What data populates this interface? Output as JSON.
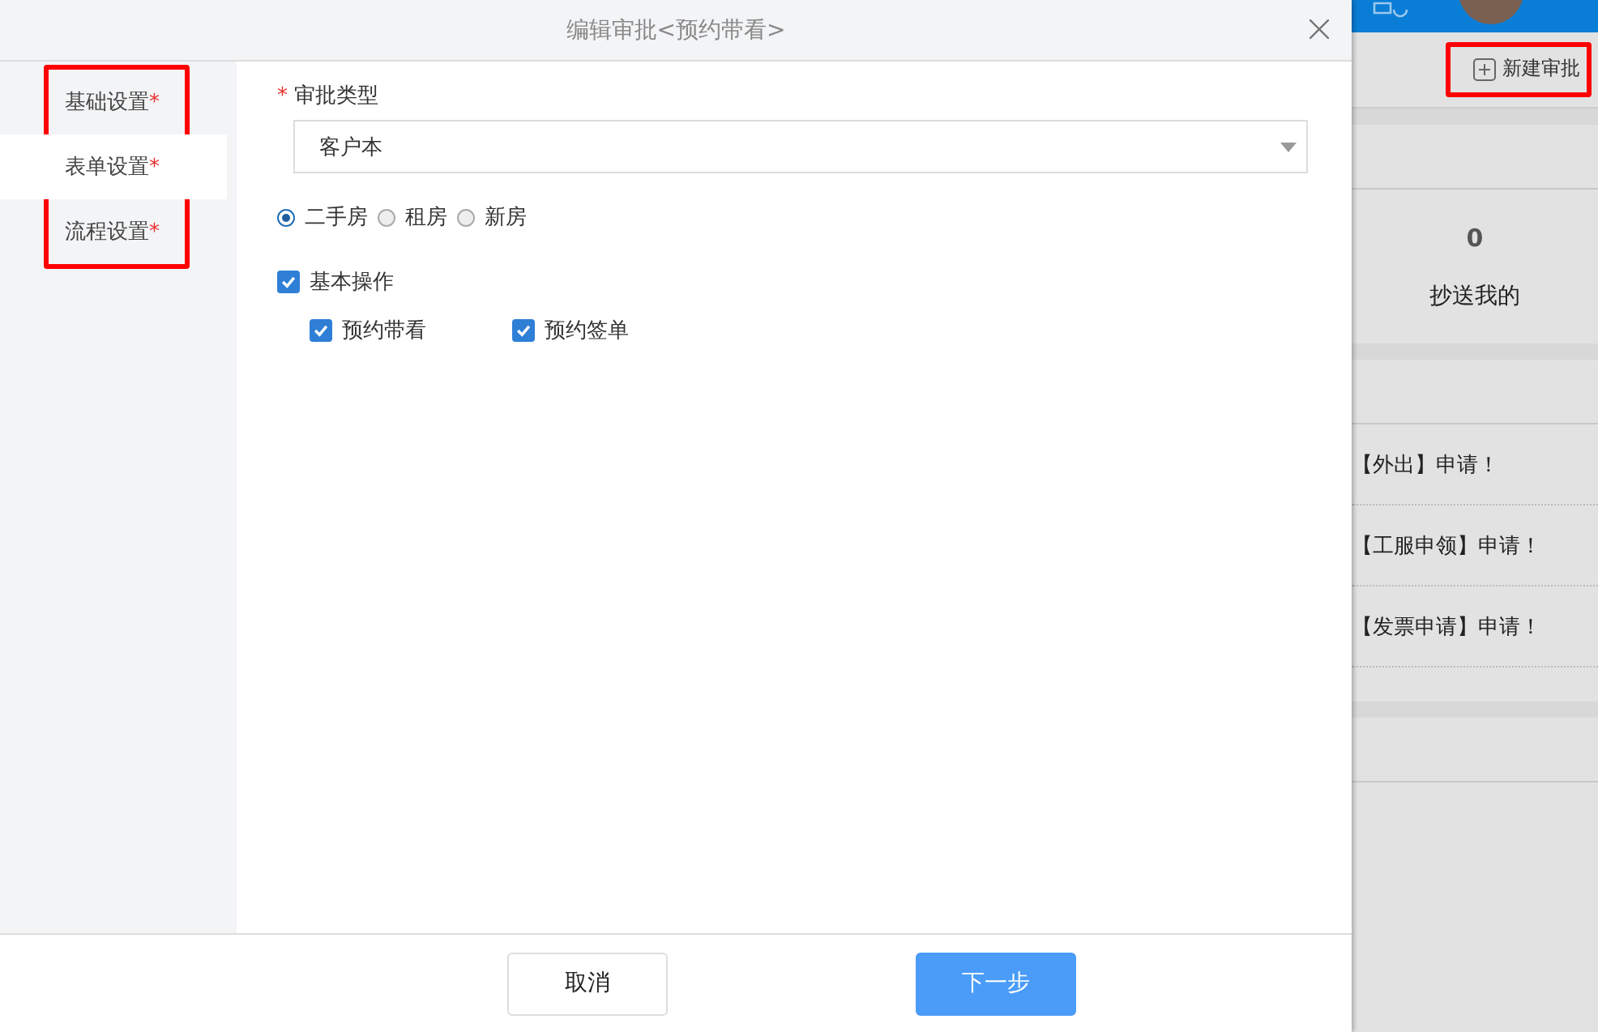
{
  "dialog": {
    "title": "编辑审批<预约带看>"
  },
  "sidebar": {
    "highlighted": true,
    "items": [
      {
        "label": "基础设置",
        "mark": "*",
        "selected": false
      },
      {
        "label": "表单设置",
        "mark": "*",
        "selected": true
      },
      {
        "label": "流程设置",
        "mark": "*",
        "selected": false
      }
    ]
  },
  "form": {
    "field_label": "审批类型",
    "required_mark": "*",
    "select": {
      "value": "客户本"
    },
    "radios": [
      {
        "label": "二手房",
        "selected": true
      },
      {
        "label": "租房",
        "selected": false
      },
      {
        "label": "新房",
        "selected": false
      }
    ],
    "checkbox_group": {
      "label": "基本操作",
      "checked": true,
      "children": [
        {
          "label": "预约带看",
          "checked": true
        },
        {
          "label": "预约签单",
          "checked": true
        }
      ]
    }
  },
  "buttons": [
    {
      "label": "取消",
      "kind": "secondary"
    },
    {
      "label": "下一步",
      "kind": "primary"
    }
  ],
  "background": {
    "new_button": {
      "label": "新建审批",
      "highlighted": true
    },
    "stat": {
      "count": "0",
      "label": "抄送我的"
    },
    "notices": [
      "【外出】申请！",
      "【工服申领】申请！",
      "【发票申请】申请！"
    ]
  }
}
